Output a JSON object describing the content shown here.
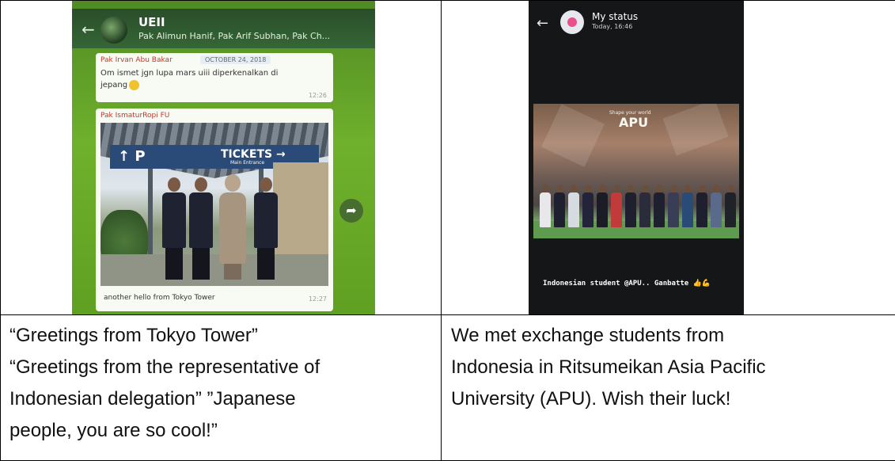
{
  "left_photo": {
    "chat": {
      "group_name": "UEII",
      "members": "Pak Alimun Hanif, Pak Arif Subhan, Pak Ch...",
      "message1": {
        "sender": "Pak Irvan Abu Bakar",
        "date": "OCTOBER 24, 2018",
        "text": "Om ismet jgn lupa mars uiii diperkenalkan di jepang",
        "time": "12:26"
      },
      "message2": {
        "sender": "Pak IsmaturRopi FU",
        "sign_parking": "↑ P",
        "sign_tickets": "TICKETS →",
        "sign_sub": "Main Entrance",
        "caption": "another hello from Tokyo Tower",
        "time": "12:27"
      },
      "icons": {
        "back": "back-arrow-icon",
        "share": "share-forward-icon",
        "emoji": "smiley-icon"
      }
    }
  },
  "right_photo": {
    "status": {
      "title": "My status",
      "time": "Today, 16:46",
      "photo_sign_small": "Shape your world",
      "photo_sign_logo": "APU",
      "caption": "Indonesian student @APU.. Ganbatte 👍💪"
    }
  },
  "captions": {
    "left": [
      "“Greetings from Tokyo Tower”",
      "“Greetings from the representative of",
      "Indonesian delegation” ”Japanese",
      "people, you are so cool!”"
    ],
    "right": [
      "We met exchange students from",
      "Indonesia in Ritsumeikan Asia Pacific",
      "University (APU). Wish their luck!"
    ]
  }
}
